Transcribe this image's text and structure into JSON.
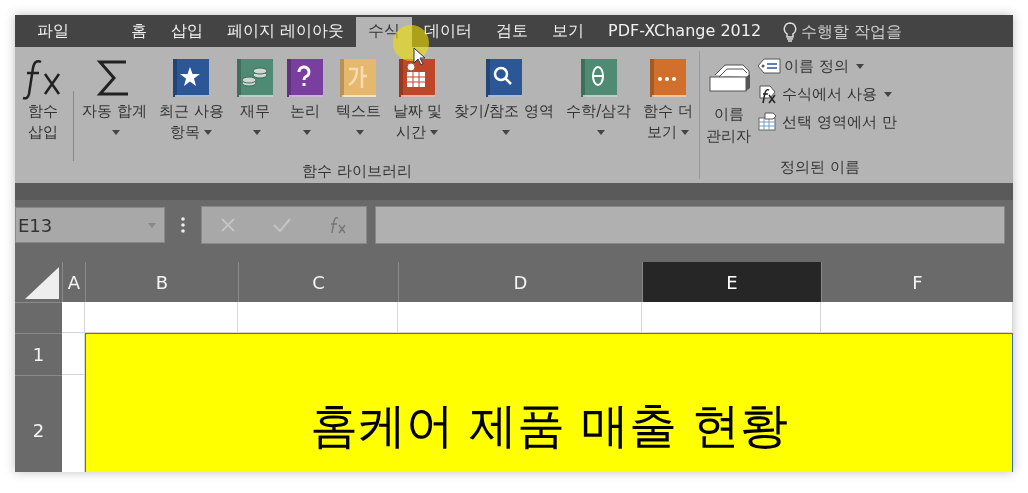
{
  "tabs": [
    {
      "label": "파일",
      "selected": false
    },
    {
      "label": "홈",
      "selected": false
    },
    {
      "label": "삽입",
      "selected": false
    },
    {
      "label": "페이지 레이아웃",
      "selected": false
    },
    {
      "label": "수식",
      "selected": true
    },
    {
      "label": "데이터",
      "selected": false
    },
    {
      "label": "검토",
      "selected": false
    },
    {
      "label": "보기",
      "selected": false
    },
    {
      "label": "PDF-XChange 2012",
      "selected": false
    }
  ],
  "tell_me": {
    "placeholder": "수행할 작업을"
  },
  "ribbon": {
    "groups": [
      {
        "label": "함수 라이브러리",
        "items": [
          {
            "kind": "fx",
            "lines": [
              "함수",
              "삽입"
            ],
            "dropdown": false
          },
          {
            "kind": "sigma",
            "lines": [
              "자동 합계"
            ],
            "dropdown": true
          },
          {
            "kind": "star",
            "color": "#2b5797",
            "lines": [
              "최근 사용",
              "항목"
            ],
            "dropdown": true
          },
          {
            "kind": "coins",
            "color": "#4f8a74",
            "lines": [
              "재무"
            ],
            "dropdown": true
          },
          {
            "kind": "question",
            "color": "#7a3f9e",
            "lines": [
              "논리"
            ],
            "dropdown": true
          },
          {
            "kind": "text",
            "color": "#e6b86e",
            "lines": [
              "텍스트"
            ],
            "dropdown": true
          },
          {
            "kind": "calendar",
            "color": "#c0462a",
            "lines": [
              "날짜 및",
              "시간"
            ],
            "dropdown": true
          },
          {
            "kind": "search",
            "color": "#2b5797",
            "lines": [
              "찾기/참조 영역"
            ],
            "dropdown": true
          },
          {
            "kind": "theta",
            "color": "#4f8a74",
            "lines": [
              "수학/삼각"
            ],
            "dropdown": true
          },
          {
            "kind": "more",
            "color": "#d0702a",
            "lines": [
              "함수 더",
              "보기"
            ],
            "dropdown": true
          }
        ]
      },
      {
        "label": "정의된 이름",
        "large": {
          "lines": [
            "이름",
            "관리자"
          ]
        },
        "small": [
          {
            "kind": "tag",
            "label": "이름 정의",
            "dropdown": true
          },
          {
            "kind": "fx-tag",
            "label": "수식에서 사용",
            "dropdown": true
          },
          {
            "kind": "table",
            "label": "선택 영역에서 만",
            "dropdown": false
          }
        ]
      }
    ]
  },
  "formula_bar": {
    "name_box": "E13"
  },
  "sheet": {
    "columns": [
      {
        "label": "A",
        "selected": false
      },
      {
        "label": "B",
        "selected": false
      },
      {
        "label": "C",
        "selected": false
      },
      {
        "label": "D",
        "selected": false
      },
      {
        "label": "E",
        "selected": true
      },
      {
        "label": "F",
        "selected": false
      }
    ],
    "rows": [
      {
        "label": ""
      },
      {
        "label": "1"
      },
      {
        "label": "2"
      }
    ],
    "title_cell": {
      "text": "홈케어 제품 매출 현황"
    }
  }
}
